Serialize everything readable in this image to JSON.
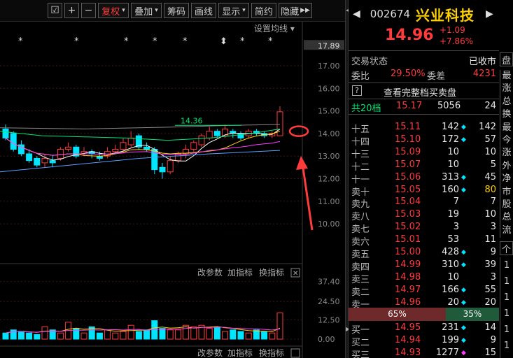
{
  "toolbar": {
    "icons": [
      "checkbox-icon",
      "plus-icon",
      "minus-icon"
    ],
    "fuquan": "复权",
    "overlay": "叠加",
    "chips": "筹码",
    "drawline": "画线",
    "display": "显示",
    "simple": "简约",
    "hide": "隐藏"
  },
  "kline": {
    "settings_label": "设置均线",
    "price_ticks": [
      "17.89",
      "17.00",
      "16.00",
      "15.00",
      "14.00",
      "13.00",
      "12.00",
      "11.00",
      "10.00"
    ],
    "annotation": "14.36",
    "markers": [
      "*",
      "*",
      "*",
      "*",
      "*",
      "⬍",
      "*",
      "*",
      "⬍"
    ]
  },
  "volume_panel": {
    "links": [
      "改参数",
      "加指标",
      "换指标"
    ],
    "ticks": [
      "37.40",
      "24.50",
      "12.50",
      "0.00"
    ],
    "links2": [
      "改参数",
      "加指标",
      "换指标"
    ],
    "close_icon": "close-icon"
  },
  "quote": {
    "code": "002674",
    "name": "兴业科技",
    "price": "14.96",
    "change": "+1.09",
    "change_pct": "+7.86%",
    "status_label": "交易状态",
    "status_value": "已收市",
    "weibi_label": "委比",
    "weibi_value": "29.50%",
    "weicha_label": "委差",
    "weicha_value": "4231",
    "help_icon": "?",
    "full_depth_label": "查看完整档买卖盘",
    "total_label": "共20档",
    "total_price": "15.17",
    "total_vol": "5056",
    "total_count": "24",
    "sell": [
      {
        "label": "十五",
        "price": "15.11",
        "vol": "142",
        "mark": "◆",
        "count": "142",
        "mark_color": "#00e5ff",
        "count_color": "#e6e6e6"
      },
      {
        "label": "十四",
        "price": "15.10",
        "vol": "172",
        "mark": "◆",
        "count": "57",
        "mark_color": "#00e5ff",
        "count_color": "#e6e6e6"
      },
      {
        "label": "十三",
        "price": "15.09",
        "vol": "10",
        "mark": "",
        "count": "10",
        "mark_color": "#00e5ff",
        "count_color": "#e6e6e6"
      },
      {
        "label": "十二",
        "price": "15.07",
        "vol": "10",
        "mark": "",
        "count": "5",
        "mark_color": "#00e5ff",
        "count_color": "#e6e6e6"
      },
      {
        "label": "十一",
        "price": "15.06",
        "vol": "313",
        "mark": "◆",
        "count": "45",
        "mark_color": "#00e5ff",
        "count_color": "#e6e6e6"
      },
      {
        "label": "卖十",
        "price": "15.05",
        "vol": "160",
        "mark": "◆",
        "count": "80",
        "mark_color": "#00e5ff",
        "count_color": "#ffd000"
      },
      {
        "label": "卖九",
        "price": "15.04",
        "vol": "7",
        "mark": "",
        "count": "7",
        "mark_color": "#00e5ff",
        "count_color": "#e6e6e6"
      },
      {
        "label": "卖八",
        "price": "15.03",
        "vol": "19",
        "mark": "",
        "count": "10",
        "mark_color": "#00e5ff",
        "count_color": "#e6e6e6"
      },
      {
        "label": "卖七",
        "price": "15.02",
        "vol": "3",
        "mark": "",
        "count": "3",
        "mark_color": "#00e5ff",
        "count_color": "#e6e6e6"
      },
      {
        "label": "卖六",
        "price": "15.01",
        "vol": "53",
        "mark": "",
        "count": "11",
        "mark_color": "#00e5ff",
        "count_color": "#e6e6e6"
      },
      {
        "label": "卖五",
        "price": "15.00",
        "vol": "428",
        "mark": "◆",
        "count": "9",
        "mark_color": "#00e5ff",
        "count_color": "#e6e6e6"
      },
      {
        "label": "卖四",
        "price": "14.99",
        "vol": "310",
        "mark": "◆",
        "count": "39",
        "mark_color": "#00e5ff",
        "count_color": "#e6e6e6"
      },
      {
        "label": "卖三",
        "price": "14.98",
        "vol": "10",
        "mark": "",
        "count": "3",
        "mark_color": "#00e5ff",
        "count_color": "#e6e6e6"
      },
      {
        "label": "卖二",
        "price": "14.97",
        "vol": "166",
        "mark": "◆",
        "count": "55",
        "mark_color": "#00e5ff",
        "count_color": "#e6e6e6"
      },
      {
        "label": "卖一",
        "price": "14.96",
        "vol": "20",
        "mark": "◆",
        "count": "20",
        "mark_color": "#00e5ff",
        "count_color": "#e6e6e6"
      }
    ],
    "ratio_sell": "65%",
    "ratio_buy": "35%",
    "buy": [
      {
        "label": "买一",
        "price": "14.95",
        "vol": "231",
        "mark": "◆",
        "count": "14",
        "mark_color": "#00e5ff",
        "count_color": "#e6e6e6"
      },
      {
        "label": "买二",
        "price": "14.94",
        "vol": "199",
        "mark": "◆",
        "count": "9",
        "mark_color": "#00e5ff",
        "count_color": "#e6e6e6"
      },
      {
        "label": "买三",
        "price": "14.93",
        "vol": "1277",
        "mark": "◆",
        "count": "15",
        "mark_color": "#ff3bff",
        "count_color": "#e6e6e6"
      }
    ],
    "side_tab_top": "盘",
    "side_labels": [
      "最",
      "涨",
      "总",
      "换",
      "最",
      "今",
      "涨",
      "外",
      "净",
      "市",
      "股",
      "总",
      "流"
    ],
    "side_tab_mid": "个",
    "side_chars_bottom": [
      "1",
      "1",
      "1",
      "1",
      "1",
      "1"
    ],
    "nav_arrows": [
      "◀",
      "▶"
    ]
  },
  "colors": {
    "up": "#ff3b3b",
    "down": "#00e5ff",
    "ma5": "#ffffff",
    "ma10": "#ffd000",
    "ma20": "#ff3bff",
    "ma30": "#00e676",
    "ma60": "#5aa0ff",
    "annotation": "#ff3b3b"
  }
}
